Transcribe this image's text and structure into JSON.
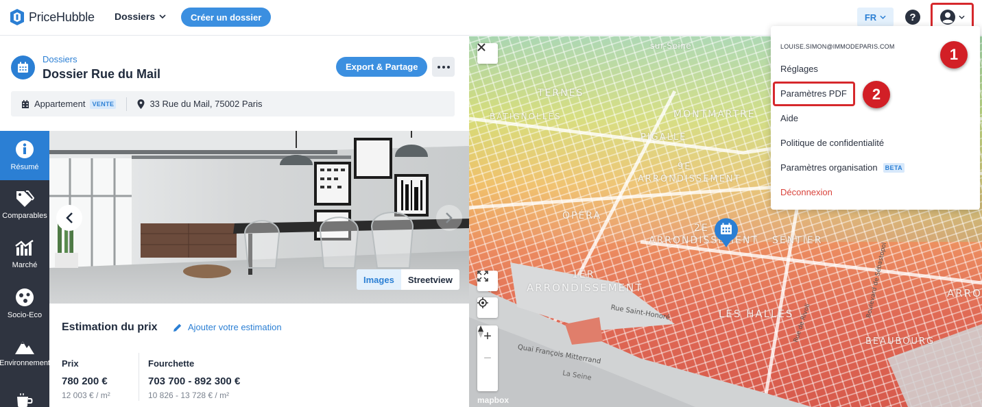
{
  "app": {
    "name": "PriceHubble"
  },
  "topbar": {
    "nav_dossiers": "Dossiers",
    "create_button": "Créer un dossier",
    "language": "FR"
  },
  "dossier": {
    "breadcrumb": "Dossiers",
    "title": "Dossier Rue du Mail",
    "export_button": "Export & Partage",
    "property_type": "Appartement",
    "transaction_badge": "VENTE",
    "address": "33 Rue du Mail, 75002 Paris"
  },
  "sidebar": {
    "items": [
      {
        "label": "Résumé",
        "icon": "info-icon",
        "active": true
      },
      {
        "label": "Comparables",
        "icon": "tags-icon",
        "active": false
      },
      {
        "label": "Marché",
        "icon": "market-chart-icon",
        "active": false
      },
      {
        "label": "Socio-Eco",
        "icon": "socio-eco-icon",
        "active": false
      },
      {
        "label": "Environnement",
        "icon": "mountain-icon",
        "active": false
      },
      {
        "label": "",
        "icon": "coffee-icon",
        "active": false
      }
    ]
  },
  "photo": {
    "tab_images": "Images",
    "tab_streetview": "Streetview"
  },
  "estimation": {
    "title": "Estimation du prix",
    "add_link": "Ajouter votre estimation",
    "price_label": "Prix",
    "price_value": "780 200 €",
    "price_per_m2": "12 003 € / m²",
    "range_label": "Fourchette",
    "range_value": "703 700 - 892 300 €",
    "range_per_m2": "10 826 - 13 728 € / m²"
  },
  "map": {
    "labels": {
      "sur_seine": "sur-Seine",
      "ternes": "TERNES",
      "batignolles": "BATIGNOLLES",
      "montmartre": "MONTMARTRE",
      "pigalle": "PIGALLE",
      "arr9_a": "9E",
      "arr9_b": "ARRONDISSEMENT",
      "opera": "OPÉRA",
      "arr2_a": "2E",
      "arr2_b": "ARRONDISSEMENT",
      "sentier": "SENTIER",
      "arr1_a": "1ER",
      "arr1_b": "ARRONDISSEMENT",
      "les_halles": "LES HALLES",
      "beaubourg": "BEAUBOURG",
      "arrondissement_edge": "ARRO",
      "rue_saint_honore": "Rue Saint-Honoré",
      "quai_mitterrand": "Quai François Mitterrand",
      "la_seine": "La Seine",
      "rue_sebastopol": "Boulevard de Sébastopol",
      "rue_rivoli": "Rue de Rivoli"
    },
    "watermark": "mapbox"
  },
  "user_menu": {
    "email": "LOUISE.SIMON@IMMODEPARIS.COM",
    "items": {
      "reglages": "Réglages",
      "pdf": "Paramètres PDF",
      "aide": "Aide",
      "privacy": "Politique de confidentialité",
      "org": "Paramètres organisation",
      "org_badge": "BETA",
      "logout": "Déconnexion"
    }
  },
  "annotations": {
    "step1": "1",
    "step2": "2"
  },
  "colors": {
    "accent": "#2b7fd4",
    "highlight": "#d6282c",
    "sidebar_bg": "#2f3440",
    "logout": "#d9433b"
  }
}
